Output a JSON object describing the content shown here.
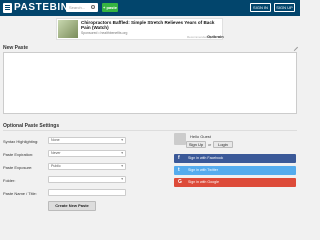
{
  "header": {
    "logo_text": "PASTEBIN",
    "search_placeholder": "Search...",
    "paste_button": "+ paste",
    "signin": "SIGN IN",
    "signup": "SIGN UP"
  },
  "ad": {
    "title": "Chiropractors Baffled: Simple Stretch Relieves Years of Back Pain (Watch)",
    "sponsor": "Sponsored • healthbenefits.org",
    "recommended": "Recommended by",
    "brand": "Outbrain"
  },
  "editor": {
    "label": "New Paste"
  },
  "options": {
    "label": "Optional Paste Settings",
    "rows": [
      {
        "label": "Syntax Highlighting:",
        "value": "None"
      },
      {
        "label": "Paste Expiration:",
        "value": "Never"
      },
      {
        "label": "Paste Exposure:",
        "value": "Public"
      },
      {
        "label": "Folder:",
        "value": ""
      },
      {
        "label": "Paste Name / Title:",
        "value": ""
      }
    ],
    "create_button": "Create New Paste"
  },
  "account": {
    "greeting": "Hello Guest",
    "signup": "Sign Up",
    "or": "or",
    "login": "Login",
    "facebook": "Sign in with Facebook",
    "twitter": "Sign in with Twitter",
    "google": "Sign in with Google"
  }
}
